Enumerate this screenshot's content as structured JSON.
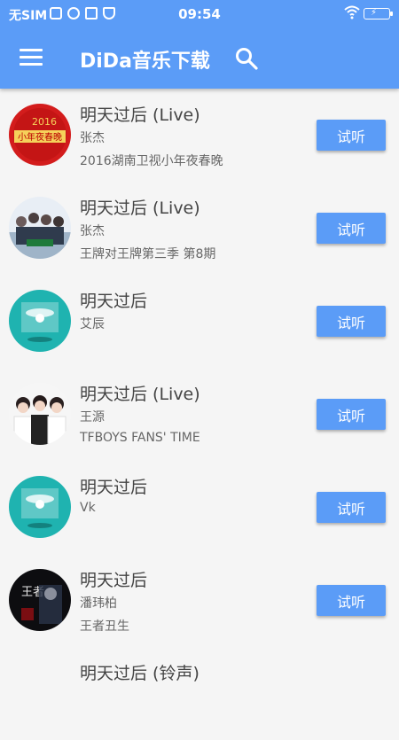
{
  "status_bar": {
    "carrier": "无SIM",
    "time": "09:54"
  },
  "app_bar": {
    "title": "DiDa音乐下载"
  },
  "play_label": "试听",
  "songs": [
    {
      "title": "明天过后 (Live)",
      "artist": "张杰",
      "album": "2016湖南卫视小年夜春晚",
      "cover": "red-event-cover"
    },
    {
      "title": "明天过后 (Live)",
      "artist": "张杰",
      "album": "王牌对王牌第三季 第8期",
      "cover": "group-photo-cover"
    },
    {
      "title": "明天过后",
      "artist": "艾辰",
      "album": "",
      "cover": "default-teal-cover"
    },
    {
      "title": "明天过后 (Live)",
      "artist": "王源",
      "album": "TFBOYS FANS' TIME",
      "cover": "trio-photo-cover"
    },
    {
      "title": "明天过后",
      "artist": "Vk",
      "album": "",
      "cover": "default-teal-cover"
    },
    {
      "title": "明天过后",
      "artist": "潘玮柏",
      "album": "王者丑生",
      "cover": "dark-album-cover"
    },
    {
      "title": "明天过后 (铃声)",
      "artist": "",
      "album": "",
      "cover": ""
    }
  ],
  "colors": {
    "primary": "#5b9cf7",
    "background": "#f5f5f5",
    "teal_cover": "#1fb3b0"
  }
}
